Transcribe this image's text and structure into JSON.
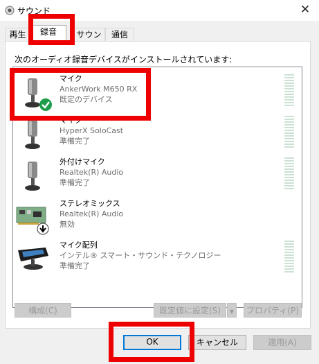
{
  "window": {
    "title": "サウンド",
    "close_glyph": "✕"
  },
  "tabs": [
    {
      "label": "再生",
      "active": false
    },
    {
      "label": "録音",
      "active": true
    },
    {
      "label": "サウンド",
      "active": false
    },
    {
      "label": "通信",
      "active": false
    }
  ],
  "prompt": "次のオーディオ録音デバイスがインストールされています:",
  "devices": [
    {
      "name": "マイク",
      "model": "AnkerWork M650 RX",
      "status": "既定のデバイス",
      "icon": "microphone-icon",
      "badge": "default-check-icon"
    },
    {
      "name": "マイク",
      "model": "HyperX SoloCast",
      "status": "準備完了",
      "icon": "microphone-icon"
    },
    {
      "name": "外付けマイク",
      "model": "Realtek(R) Audio",
      "status": "準備完了",
      "icon": "microphone-icon"
    },
    {
      "name": "ステレオミックス",
      "model": "Realtek(R) Audio",
      "status": "無効",
      "icon": "circuit-board-icon",
      "badge": "disabled-arrow-icon"
    },
    {
      "name": "マイク配列",
      "model": "インテル® スマート・サウンド・テクノロジー",
      "status": "準備完了",
      "icon": "webcam-array-icon"
    }
  ],
  "buttons": {
    "configure": "構成(C)",
    "set_default": "既定値に設定(S)",
    "properties": "プロパティ(P)",
    "ok": "OK",
    "cancel": "キャンセル",
    "apply": "適用(A)"
  },
  "colors": {
    "highlight": "#ee0000",
    "default_check": "#1e9e4a",
    "focus_border": "#0078d7"
  }
}
